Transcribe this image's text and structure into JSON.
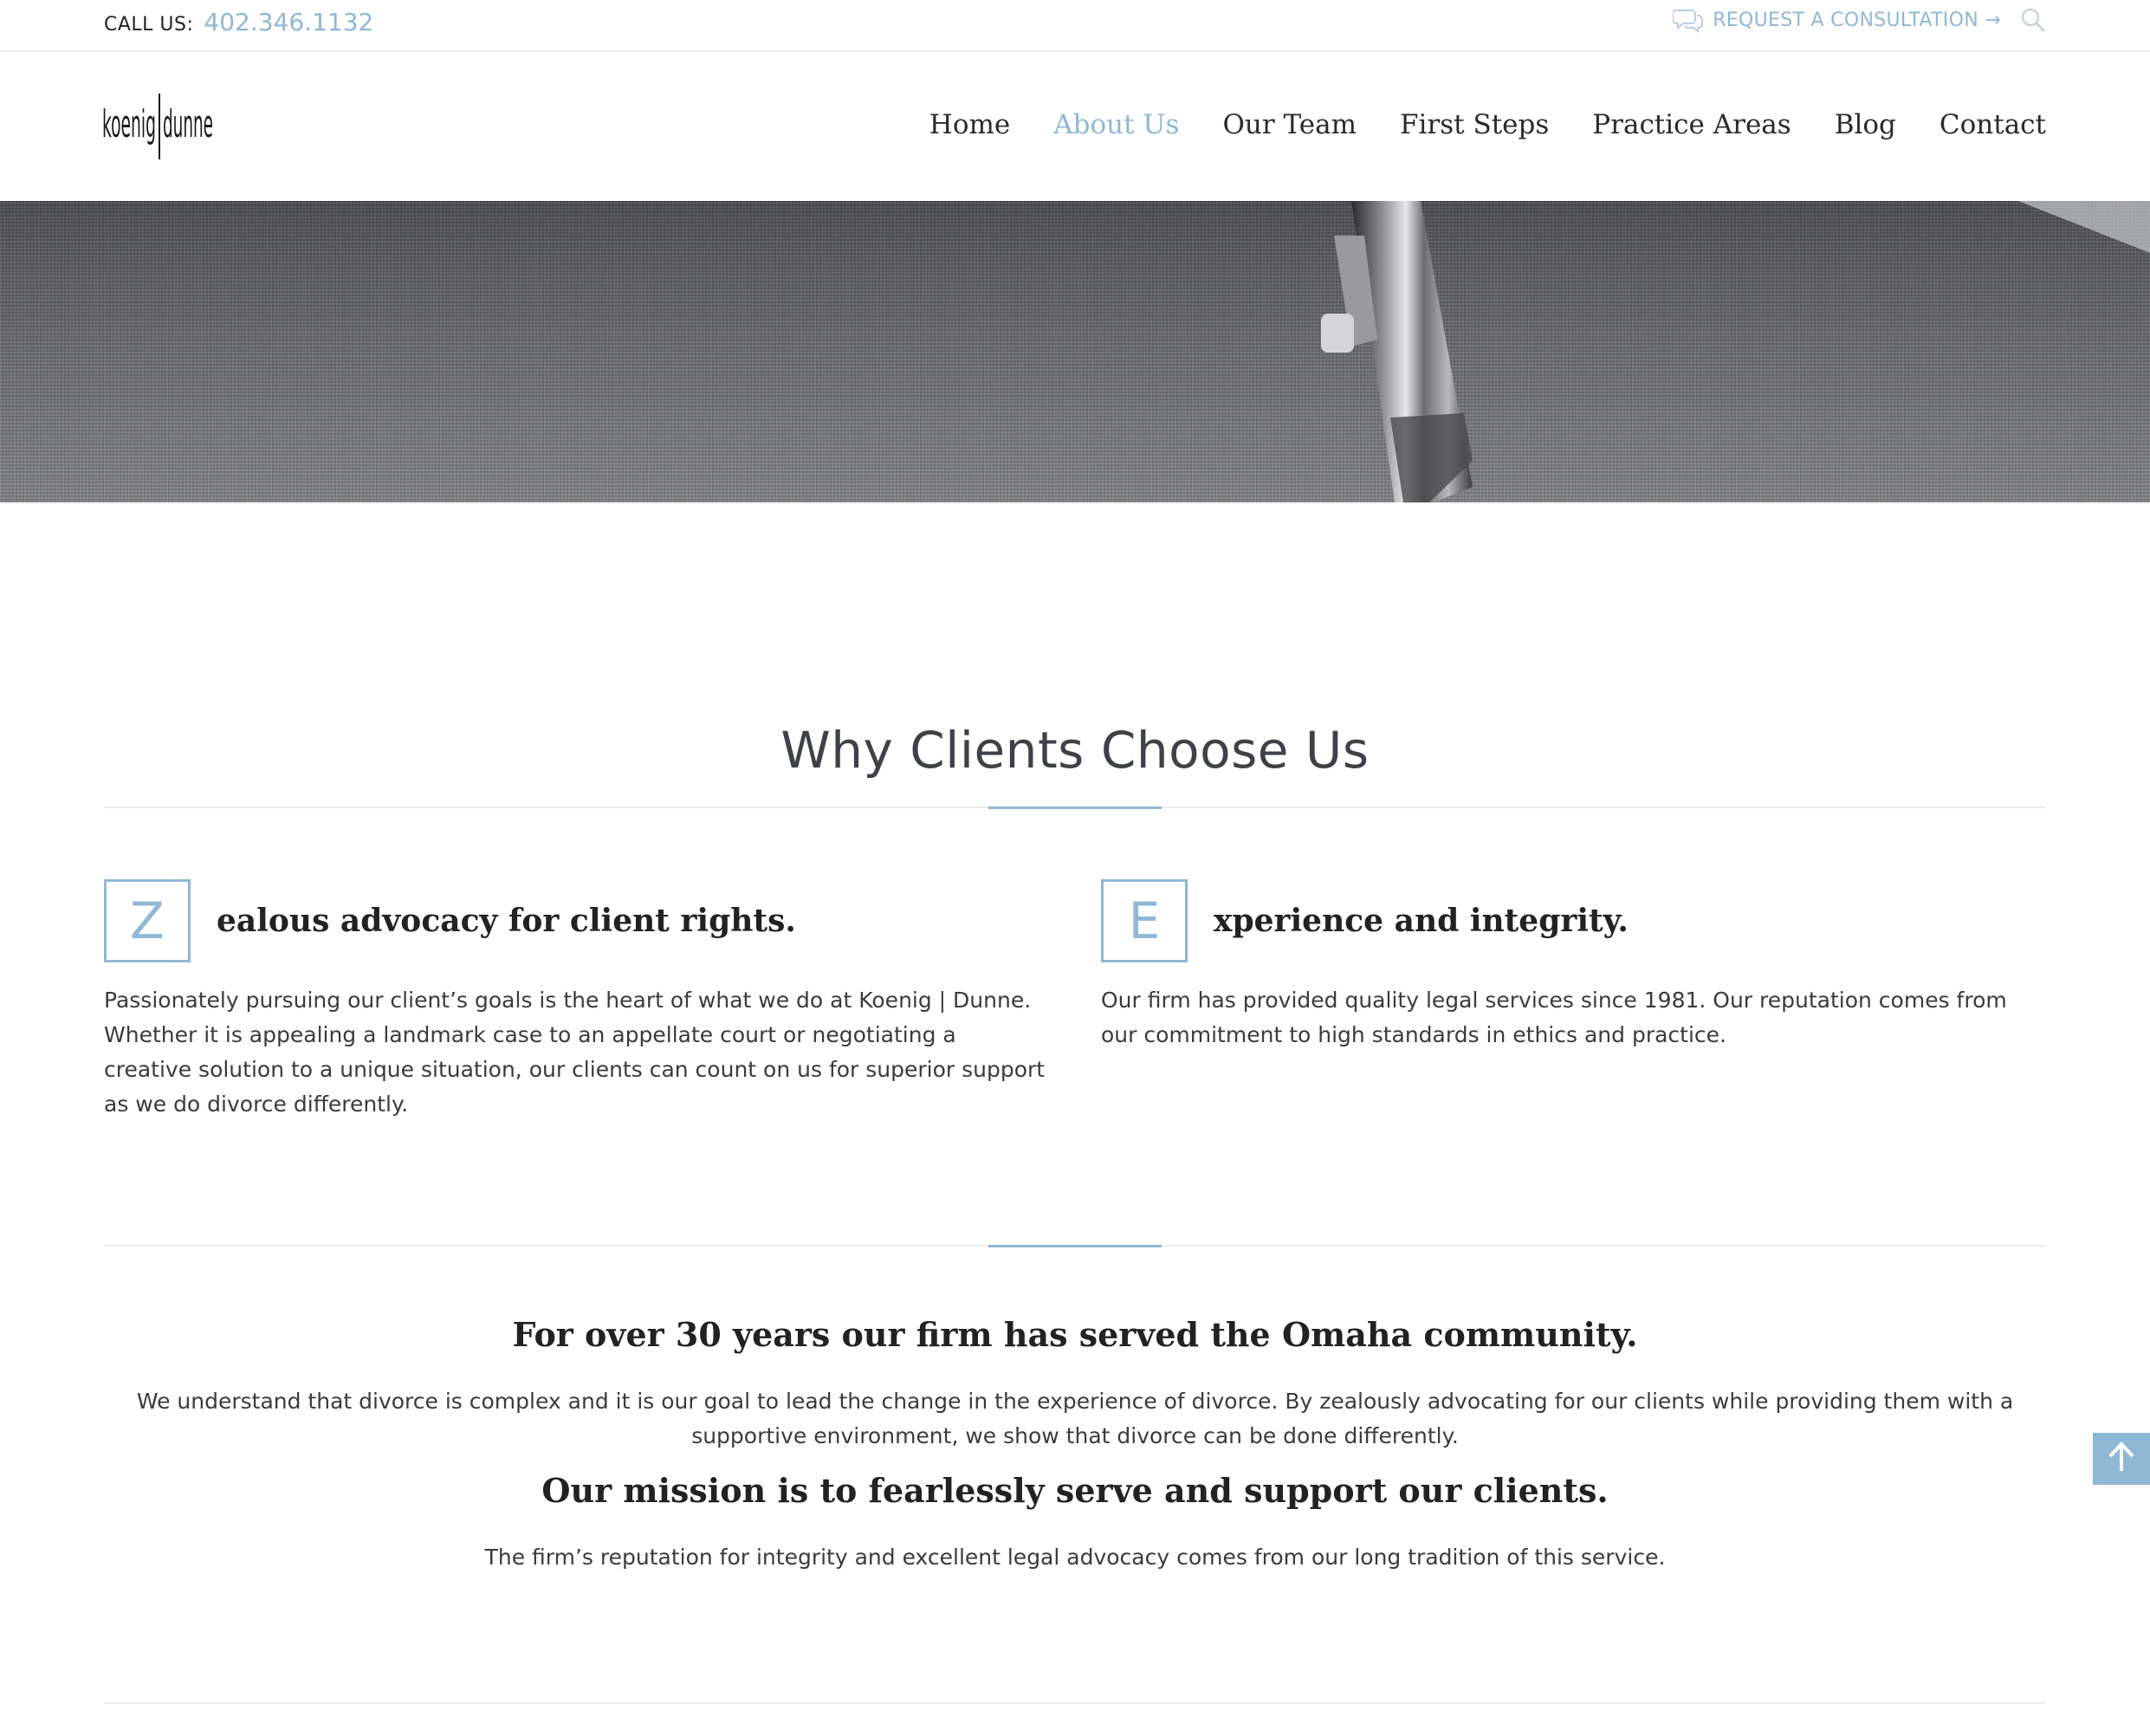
{
  "topbar": {
    "call_label": "CALL US:",
    "phone": "402.346.1132",
    "consult_label": "REQUEST A CONSULTATION →"
  },
  "header": {
    "logo_text": "koenig|dunne",
    "nav": [
      {
        "label": "Home",
        "active": false
      },
      {
        "label": "About Us",
        "active": true
      },
      {
        "label": "Our Team",
        "active": false
      },
      {
        "label": "First Steps",
        "active": false
      },
      {
        "label": "Practice Areas",
        "active": false
      },
      {
        "label": "Blog",
        "active": false
      },
      {
        "label": "Contact",
        "active": false
      }
    ]
  },
  "why": {
    "title": "Why Clients Choose Us",
    "features": [
      {
        "letter": "Z",
        "title": "ealous advocacy for client rights.",
        "body": "Passionately pursuing our client’s goals is the heart of what we do at Koenig | Dunne. Whether it is appealing a landmark case to an appellate court or negotiating a creative solution to a unique situation, our clients can count on us for superior support as we do divorce differently."
      },
      {
        "letter": "E",
        "title": "xperience and integrity.",
        "body": "Our firm has provided quality legal services since 1981. Our reputation comes from our commitment to high standards in ethics and practice."
      }
    ]
  },
  "community": {
    "title": "For over 30 years our firm has served the Omaha community.",
    "body": "We understand that divorce is complex and it is our goal to lead the change in the experience of divorce. By zealously advocating for our clients while providing them with a supportive environment, we show that divorce can be done differently."
  },
  "mission": {
    "title": "Our mission is to fearlessly serve and support our clients.",
    "body": "The firm’s reputation for integrity and excellent legal advocacy comes from our long tradition of this service."
  },
  "colors": {
    "accent": "#8fb8d4",
    "text": "#3b3b3b",
    "heading": "#222222"
  },
  "icons": [
    "chat-bubbles-icon",
    "search-icon",
    "arrow-up-icon"
  ]
}
